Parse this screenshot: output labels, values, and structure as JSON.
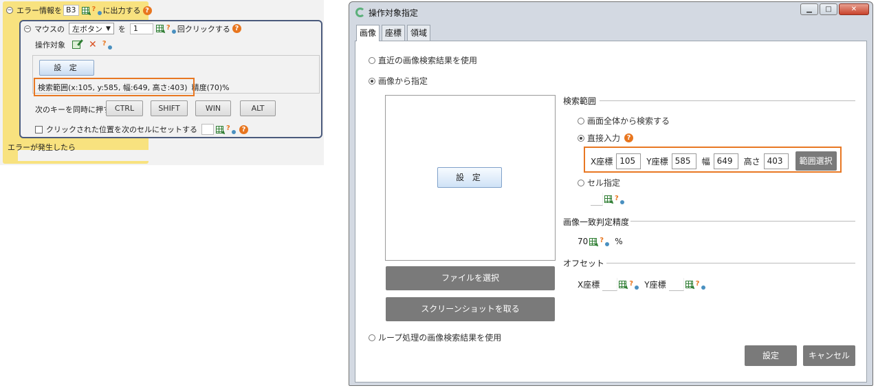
{
  "left": {
    "error_row": {
      "prefix": "エラー情報を",
      "cell": "B3",
      "suffix": "に出力する"
    },
    "mouse_row": {
      "prefix": "マウスの",
      "button": "左ボタン",
      "wo": "を",
      "count": "1",
      "suffix": "回クリックする"
    },
    "target_label": "操作対象",
    "settei_label": "設 定",
    "search_range_text": "検索範囲(x:105, y:585, 幅:649, 高さ:403)",
    "accuracy_text": "精度(70)%",
    "keys_label": "次のキーを同時に押す",
    "keys": [
      "CTRL",
      "SHIFT",
      "WIN",
      "ALT"
    ],
    "checkbox_label": "クリックされた位置を次のセルにセットする",
    "on_error": "エラーが発生したら"
  },
  "dialog": {
    "title": "操作対象指定",
    "window_buttons": {
      "minimize": "▁",
      "maximize": "□",
      "close": "✕"
    },
    "tabs": [
      "画像",
      "座標",
      "領域"
    ],
    "radio_recent": "直近の画像検索結果を使用",
    "radio_from_image": "画像から指定",
    "image_settei": "設 定",
    "file_select": "ファイルを選択",
    "screenshot": "スクリーンショットを取る",
    "radio_loop": "ループ処理の画像検索結果を使用",
    "search_range": {
      "label": "検索範囲",
      "option_full": "画面全体から検索する",
      "option_direct": "直接入力",
      "x_label": "X座標",
      "x": "105",
      "y_label": "Y座標",
      "y": "585",
      "w_label": "幅",
      "w": "649",
      "h_label": "高さ",
      "h": "403",
      "range_select": "範囲選択",
      "option_cell": "セル指定"
    },
    "accuracy": {
      "label": "画像一致判定精度",
      "value": "70",
      "unit": "%"
    },
    "offset": {
      "label": "オフセット",
      "x_label": "X座標",
      "y_label": "Y座標"
    },
    "ok": "設定",
    "cancel": "キャンセル"
  },
  "colors": {
    "highlight": "#e87722",
    "yellow_panel": "#f8e27f",
    "gray_button": "#7a7a7a",
    "help": "#e8761f"
  }
}
